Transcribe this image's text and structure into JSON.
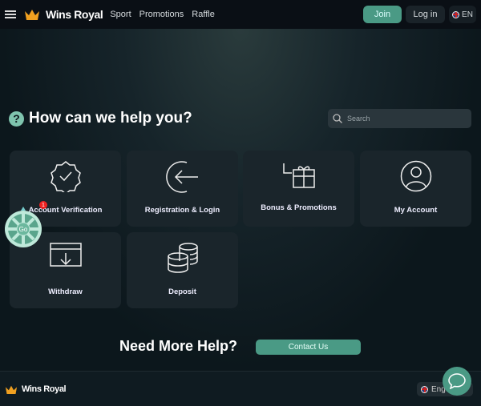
{
  "header": {
    "brand": "Wins Royal",
    "nav": [
      "Sport",
      "Promotions",
      "Raffle"
    ],
    "join": "Join",
    "login": "Log in",
    "lang": "EN"
  },
  "help": {
    "title": "How can we help you?",
    "search_placeholder": "Search"
  },
  "cards": [
    "Account Verification",
    "Registration & Login",
    "Bonus & Promotions",
    "My Account",
    "Withdraw",
    "Deposit"
  ],
  "more": {
    "title": "Need More Help?",
    "contact": "Contact Us"
  },
  "wheel": {
    "label": "Go",
    "badge": "1"
  },
  "footer": {
    "brand": "Wins Royal",
    "lang": "Eng"
  },
  "colors": {
    "accent": "#4a9a85",
    "card": "#1a252b"
  }
}
